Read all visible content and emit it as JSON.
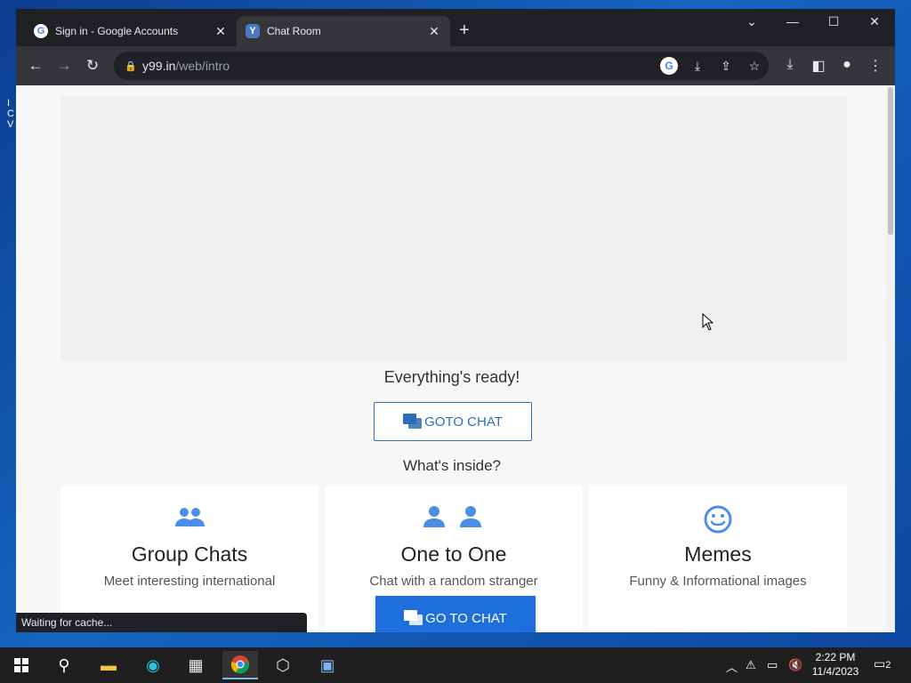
{
  "browser": {
    "tabs": [
      {
        "title": "Sign in - Google Accounts",
        "favicon": "google-icon"
      },
      {
        "title": "Chat Room",
        "favicon": "y99-icon"
      }
    ],
    "address": {
      "host": "y99.in",
      "path": "/web/intro"
    },
    "status_text": "Waiting for cache..."
  },
  "page": {
    "ready_text": "Everything's ready!",
    "goto_chat_label": "GOTO CHAT",
    "whats_inside": "What's inside?",
    "features": [
      {
        "icon": "group-icon",
        "title": "Group Chats",
        "description": "Meet interesting international"
      },
      {
        "icon": "one-to-one-icon",
        "title": "One to One",
        "description": "Chat with a random stranger"
      },
      {
        "icon": "smiley-icon",
        "title": "Memes",
        "description": "Funny & Informational images"
      }
    ],
    "sticky_button_label": "GO TO CHAT"
  },
  "taskbar": {
    "time": "2:22 PM",
    "date": "11/4/2023",
    "notification_count": "2"
  },
  "colors": {
    "accent": "#1e6fd9",
    "outline_button": "#2a6fb7",
    "feature_icon": "#4b8ee6"
  }
}
